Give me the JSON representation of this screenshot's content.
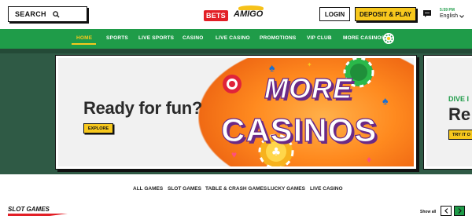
{
  "header": {
    "search_label": "SEARCH",
    "logo_bets": "BETS",
    "logo_amigo": "AMIGO",
    "login_label": "LOGIN",
    "deposit_label": "DEPOSIT & PLAY",
    "time": "5:59 PM",
    "language": "English"
  },
  "nav": {
    "items": [
      {
        "label": "HOME"
      },
      {
        "label": "SPORTS"
      },
      {
        "label": "LIVE SPORTS"
      },
      {
        "label": "CASINO"
      },
      {
        "label": "LIVE CASINO"
      },
      {
        "label": "PROMOTIONS"
      },
      {
        "label": "VIP CLUB"
      },
      {
        "label": "MORE CASINOS"
      }
    ]
  },
  "hero": {
    "title": "Ready for fun?",
    "cta": "EXPLORE",
    "banner_line1": "MORE",
    "banner_line2": "CASINOS",
    "next_card": {
      "kicker": "DIVE I",
      "title": "Re",
      "cta": "TRY IT O"
    }
  },
  "categories": {
    "tabs": [
      {
        "label": "ALL GAMES"
      },
      {
        "label": "SLOT GAMES"
      },
      {
        "label": "TABLE & CRASH GAMES"
      },
      {
        "label": "LUCKY GAMES"
      },
      {
        "label": "LIVE CASINO"
      }
    ],
    "section_title": "SLOT GAMES",
    "show_all": "Show all"
  },
  "colors": {
    "brand_green": "#1f9c49",
    "accent_yellow": "#f7c81d",
    "brand_red": "#e21f26",
    "hero_bg": "#2f5a45"
  }
}
